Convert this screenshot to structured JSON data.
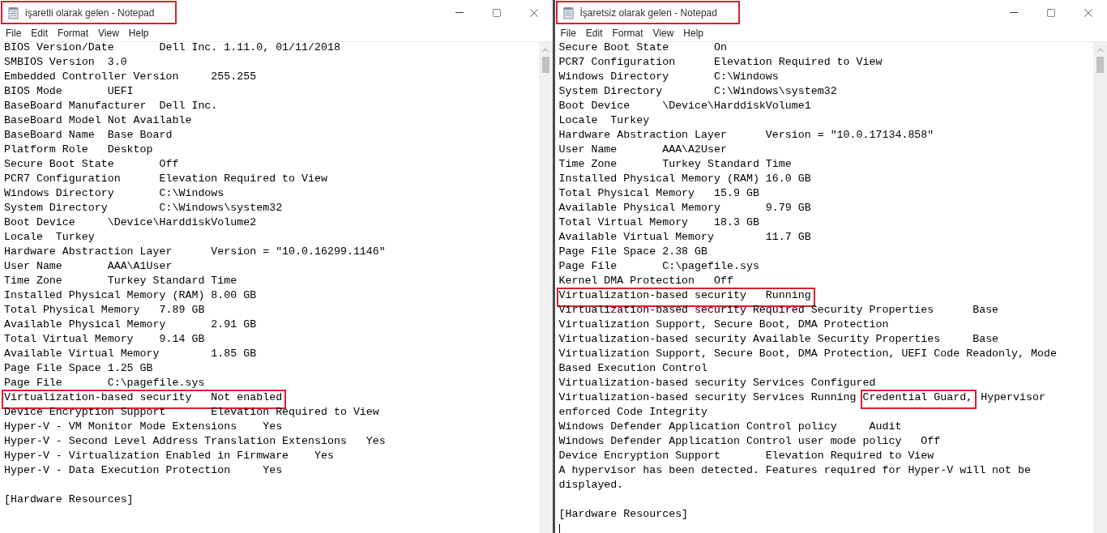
{
  "windows": [
    {
      "title": "işaretli olarak gelen - Notepad",
      "title_marked": true,
      "caret": false,
      "menu": [
        "File",
        "Edit",
        "Format",
        "View",
        "Help"
      ],
      "lines": [
        {
          "kind": "text",
          "parts": [
            {
              "text": "BIOS Version/Date       Dell Inc. 1.11.0, 01/11/2018",
              "marked": false
            }
          ]
        },
        {
          "kind": "text",
          "parts": [
            {
              "text": "SMBIOS Version  3.0",
              "marked": false
            }
          ]
        },
        {
          "kind": "text",
          "parts": [
            {
              "text": "Embedded Controller Version     255.255",
              "marked": false
            }
          ]
        },
        {
          "kind": "text",
          "parts": [
            {
              "text": "BIOS Mode       UEFI",
              "marked": false
            }
          ]
        },
        {
          "kind": "text",
          "parts": [
            {
              "text": "BaseBoard Manufacturer  Dell Inc.",
              "marked": false
            }
          ]
        },
        {
          "kind": "text",
          "parts": [
            {
              "text": "BaseBoard Model Not Available",
              "marked": false
            }
          ]
        },
        {
          "kind": "text",
          "parts": [
            {
              "text": "BaseBoard Name  Base Board",
              "marked": false
            }
          ]
        },
        {
          "kind": "text",
          "parts": [
            {
              "text": "Platform Role   Desktop",
              "marked": false
            }
          ]
        },
        {
          "kind": "text",
          "parts": [
            {
              "text": "Secure Boot State       Off",
              "marked": false
            }
          ]
        },
        {
          "kind": "text",
          "parts": [
            {
              "text": "PCR7 Configuration      Elevation Required to View",
              "marked": false
            }
          ]
        },
        {
          "kind": "text",
          "parts": [
            {
              "text": "Windows Directory       C:\\Windows",
              "marked": false
            }
          ]
        },
        {
          "kind": "text",
          "parts": [
            {
              "text": "System Directory        C:\\Windows\\system32",
              "marked": false
            }
          ]
        },
        {
          "kind": "text",
          "parts": [
            {
              "text": "Boot Device     \\Device\\HarddiskVolume2",
              "marked": false
            }
          ]
        },
        {
          "kind": "text",
          "parts": [
            {
              "text": "Locale  Turkey",
              "marked": false
            }
          ]
        },
        {
          "kind": "text",
          "parts": [
            {
              "text": "Hardware Abstraction Layer      Version = \"10.0.16299.1146\"",
              "marked": false
            }
          ]
        },
        {
          "kind": "text",
          "parts": [
            {
              "text": "User Name       AAA\\A1User",
              "marked": false
            }
          ]
        },
        {
          "kind": "text",
          "parts": [
            {
              "text": "Time Zone       Turkey Standard Time",
              "marked": false
            }
          ]
        },
        {
          "kind": "text",
          "parts": [
            {
              "text": "Installed Physical Memory (RAM) 8.00 GB",
              "marked": false
            }
          ]
        },
        {
          "kind": "text",
          "parts": [
            {
              "text": "Total Physical Memory   7.89 GB",
              "marked": false
            }
          ]
        },
        {
          "kind": "text",
          "parts": [
            {
              "text": "Available Physical Memory       2.91 GB",
              "marked": false
            }
          ]
        },
        {
          "kind": "text",
          "parts": [
            {
              "text": "Total Virtual Memory    9.14 GB",
              "marked": false
            }
          ]
        },
        {
          "kind": "text",
          "parts": [
            {
              "text": "Available Virtual Memory        1.85 GB",
              "marked": false
            }
          ]
        },
        {
          "kind": "text",
          "parts": [
            {
              "text": "Page File Space 1.25 GB",
              "marked": false
            }
          ]
        },
        {
          "kind": "text",
          "parts": [
            {
              "text": "Page File       C:\\pagefile.sys",
              "marked": false
            }
          ]
        },
        {
          "kind": "text",
          "parts": [
            {
              "text": "Virtualization-based security   Not enabled",
              "marked": true
            }
          ]
        },
        {
          "kind": "text",
          "parts": [
            {
              "text": "Device Encryption Support       Elevation Required to View",
              "marked": false
            }
          ]
        },
        {
          "kind": "text",
          "parts": [
            {
              "text": "Hyper-V - VM Monitor Mode Extensions    Yes",
              "marked": false
            }
          ]
        },
        {
          "kind": "text",
          "parts": [
            {
              "text": "Hyper-V - Second Level Address Translation Extensions   Yes",
              "marked": false
            }
          ]
        },
        {
          "kind": "text",
          "parts": [
            {
              "text": "Hyper-V - Virtualization Enabled in Firmware    Yes",
              "marked": false
            }
          ]
        },
        {
          "kind": "text",
          "parts": [
            {
              "text": "Hyper-V - Data Execution Protection     Yes",
              "marked": false
            }
          ]
        },
        {
          "kind": "blank"
        },
        {
          "kind": "text",
          "parts": [
            {
              "text": "[Hardware Resources]",
              "marked": false
            }
          ]
        }
      ]
    },
    {
      "title": "İşaretsiz olarak gelen - Notepad",
      "title_marked": true,
      "caret": true,
      "menu": [
        "File",
        "Edit",
        "Format",
        "View",
        "Help"
      ],
      "lines": [
        {
          "kind": "text",
          "parts": [
            {
              "text": "Secure Boot State       On",
              "marked": false
            }
          ]
        },
        {
          "kind": "text",
          "parts": [
            {
              "text": "PCR7 Configuration      Elevation Required to View",
              "marked": false
            }
          ]
        },
        {
          "kind": "text",
          "parts": [
            {
              "text": "Windows Directory       C:\\Windows",
              "marked": false
            }
          ]
        },
        {
          "kind": "text",
          "parts": [
            {
              "text": "System Directory        C:\\Windows\\system32",
              "marked": false
            }
          ]
        },
        {
          "kind": "text",
          "parts": [
            {
              "text": "Boot Device     \\Device\\HarddiskVolume1",
              "marked": false
            }
          ]
        },
        {
          "kind": "text",
          "parts": [
            {
              "text": "Locale  Turkey",
              "marked": false
            }
          ]
        },
        {
          "kind": "text",
          "parts": [
            {
              "text": "Hardware Abstraction Layer      Version = \"10.0.17134.858\"",
              "marked": false
            }
          ]
        },
        {
          "kind": "text",
          "parts": [
            {
              "text": "User Name       AAA\\A2User",
              "marked": false
            }
          ]
        },
        {
          "kind": "text",
          "parts": [
            {
              "text": "Time Zone       Turkey Standard Time",
              "marked": false
            }
          ]
        },
        {
          "kind": "text",
          "parts": [
            {
              "text": "Installed Physical Memory (RAM) 16.0 GB",
              "marked": false
            }
          ]
        },
        {
          "kind": "text",
          "parts": [
            {
              "text": "Total Physical Memory   15.9 GB",
              "marked": false
            }
          ]
        },
        {
          "kind": "text",
          "parts": [
            {
              "text": "Available Physical Memory       9.79 GB",
              "marked": false
            }
          ]
        },
        {
          "kind": "text",
          "parts": [
            {
              "text": "Total Virtual Memory    18.3 GB",
              "marked": false
            }
          ]
        },
        {
          "kind": "text",
          "parts": [
            {
              "text": "Available Virtual Memory        11.7 GB",
              "marked": false
            }
          ]
        },
        {
          "kind": "text",
          "parts": [
            {
              "text": "Page File Space 2.38 GB",
              "marked": false
            }
          ]
        },
        {
          "kind": "text",
          "parts": [
            {
              "text": "Page File       C:\\pagefile.sys",
              "marked": false
            }
          ]
        },
        {
          "kind": "text",
          "parts": [
            {
              "text": "Kernel DMA Protection   Off",
              "marked": false
            }
          ]
        },
        {
          "kind": "text",
          "parts": [
            {
              "text": "Virtualization-based security   Running",
              "marked": true
            }
          ]
        },
        {
          "kind": "text",
          "parts": [
            {
              "text": "Virtualization-based security Required Security Properties      Base",
              "marked": false
            }
          ]
        },
        {
          "kind": "text",
          "parts": [
            {
              "text": "Virtualization Support, Secure Boot, DMA Protection",
              "marked": false
            }
          ]
        },
        {
          "kind": "text",
          "parts": [
            {
              "text": "Virtualization-based security Available Security Properties     Base",
              "marked": false
            }
          ]
        },
        {
          "kind": "text",
          "parts": [
            {
              "text": "Virtualization Support, Secure Boot, DMA Protection, UEFI Code Readonly, Mode",
              "marked": false
            }
          ]
        },
        {
          "kind": "text",
          "parts": [
            {
              "text": "Based Execution Control",
              "marked": false
            }
          ]
        },
        {
          "kind": "text",
          "parts": [
            {
              "text": "Virtualization-based security Services Configured",
              "marked": false
            }
          ]
        },
        {
          "kind": "text",
          "parts": [
            {
              "text": "Virtualization-based security Services Running ",
              "marked": false
            },
            {
              "text": "Credential Guard,",
              "marked": true
            },
            {
              "text": " Hypervisor",
              "marked": false
            }
          ]
        },
        {
          "kind": "text",
          "parts": [
            {
              "text": "enforced Code Integrity",
              "marked": false
            }
          ]
        },
        {
          "kind": "text",
          "parts": [
            {
              "text": "Windows Defender Application Control policy     Audit",
              "marked": false
            }
          ]
        },
        {
          "kind": "text",
          "parts": [
            {
              "text": "Windows Defender Application Control user mode policy   Off",
              "marked": false
            }
          ]
        },
        {
          "kind": "text",
          "parts": [
            {
              "text": "Device Encryption Support       Elevation Required to View",
              "marked": false
            }
          ]
        },
        {
          "kind": "text",
          "parts": [
            {
              "text": "A hypervisor has been detected. Features required for Hyper-V will not be",
              "marked": false
            }
          ]
        },
        {
          "kind": "text",
          "parts": [
            {
              "text": "displayed.",
              "marked": false
            }
          ]
        },
        {
          "kind": "blank"
        },
        {
          "kind": "text",
          "parts": [
            {
              "text": "[Hardware Resources]",
              "marked": false
            }
          ]
        }
      ]
    }
  ]
}
